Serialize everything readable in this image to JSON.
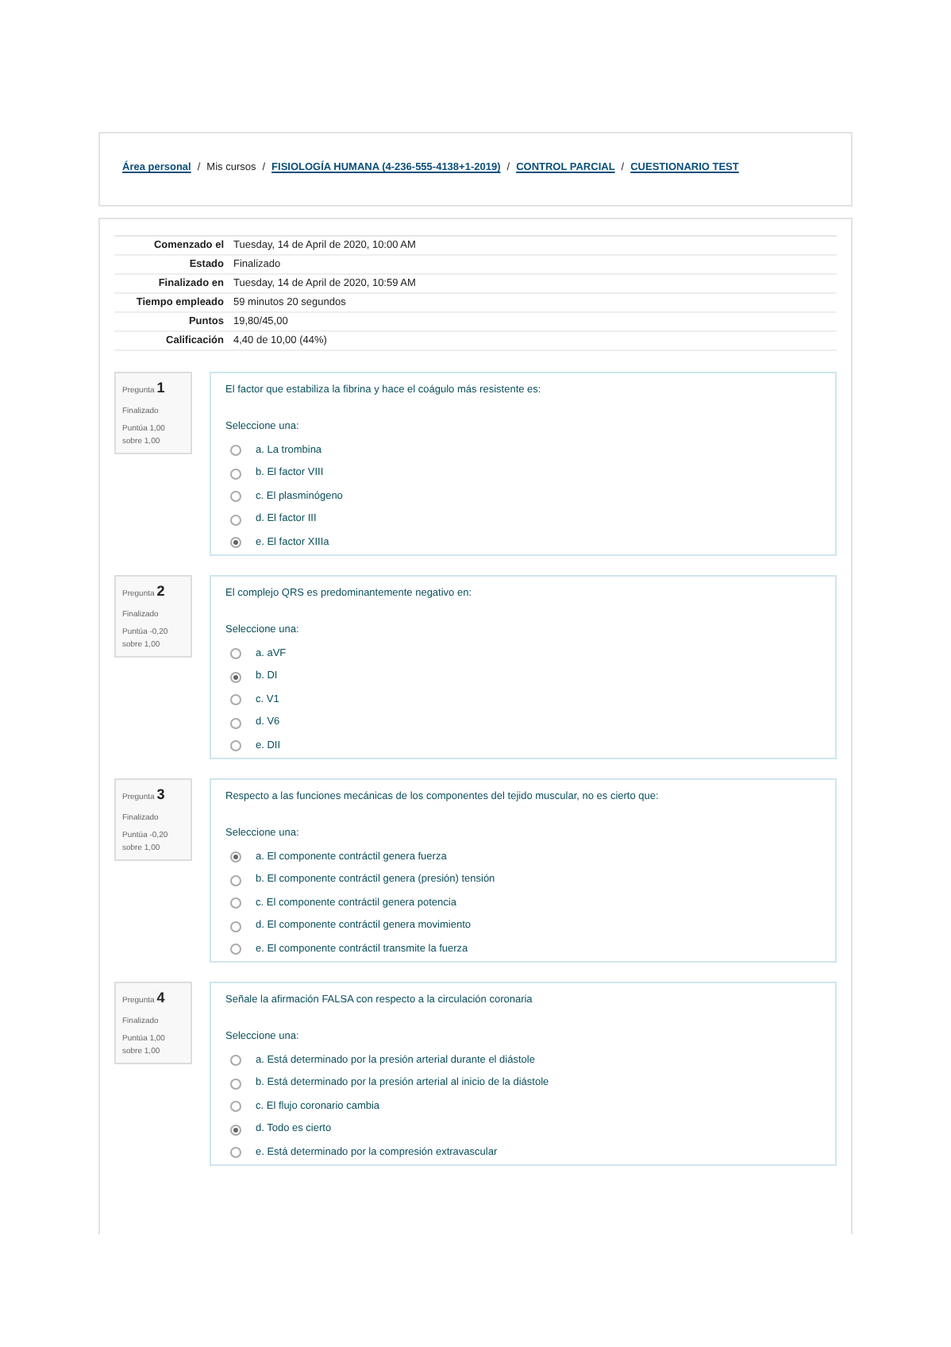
{
  "breadcrumb": {
    "separator": "/",
    "items": [
      {
        "label": "Área personal",
        "link": true
      },
      {
        "label": "Mis cursos",
        "link": false
      },
      {
        "label": "FISIOLOGÍA HUMANA (4-236-555-4138+1-2019)",
        "link": true
      },
      {
        "label": "CONTROL PARCIAL",
        "link": true
      },
      {
        "label": "CUESTIONARIO TEST",
        "link": true
      }
    ]
  },
  "summary": [
    {
      "label": "Comenzado el",
      "value": "Tuesday, 14 de April de 2020, 10:00 AM"
    },
    {
      "label": "Estado",
      "value": "Finalizado"
    },
    {
      "label": "Finalizado en",
      "value": "Tuesday, 14 de April de 2020, 10:59 AM"
    },
    {
      "label": "Tiempo empleado",
      "value": "59 minutos 20 segundos"
    },
    {
      "label": "Puntos",
      "value": "19,80/45,00"
    },
    {
      "label": "Calificación",
      "value": "4,40 de 10,00 (44%)"
    }
  ],
  "questions": [
    {
      "label": "Pregunta",
      "number": "1",
      "state": "Finalizado",
      "grade": "Puntúa 1,00 sobre 1,00",
      "text": "El factor que estabiliza la fibrina y hace el coágulo más resistente es:",
      "prompt": "Seleccione una:",
      "options": [
        {
          "label": "a. La trombina",
          "selected": false
        },
        {
          "label": "b. El factor VIII",
          "selected": false
        },
        {
          "label": "c. El plasminógeno",
          "selected": false
        },
        {
          "label": "d. El factor III",
          "selected": false
        },
        {
          "label": "e. El factor XIIIa",
          "selected": true
        }
      ]
    },
    {
      "label": "Pregunta",
      "number": "2",
      "state": "Finalizado",
      "grade": "Puntúa -0,20 sobre 1,00",
      "text": "El complejo QRS es predominantemente negativo en:",
      "prompt": "Seleccione una:",
      "options": [
        {
          "label": "a. aVF",
          "selected": false
        },
        {
          "label": "b. DI",
          "selected": true
        },
        {
          "label": "c. V1",
          "selected": false
        },
        {
          "label": "d. V6",
          "selected": false
        },
        {
          "label": "e. DII",
          "selected": false
        }
      ]
    },
    {
      "label": "Pregunta",
      "number": "3",
      "state": "Finalizado",
      "grade": "Puntúa -0,20 sobre 1,00",
      "text": "Respecto a las funciones mecánicas de los componentes del tejido muscular, no es cierto que:",
      "prompt": "Seleccione una:",
      "options": [
        {
          "label": "a. El componente contráctil genera fuerza",
          "selected": true
        },
        {
          "label": "b. El componente contráctil genera (presión) tensión",
          "selected": false
        },
        {
          "label": "c. El componente contráctil genera potencia",
          "selected": false
        },
        {
          "label": "d. El componente contráctil genera movimiento",
          "selected": false
        },
        {
          "label": "e. El componente contráctil transmite la fuerza",
          "selected": false
        }
      ]
    },
    {
      "label": "Pregunta",
      "number": "4",
      "state": "Finalizado",
      "grade": "Puntúa 1,00 sobre 1,00",
      "text": "Señale la afirmación FALSA con respecto a la circulación coronaria",
      "prompt": "Seleccione una:",
      "options": [
        {
          "label": "a. Está determinado por la presión arterial durante el diástole",
          "selected": false
        },
        {
          "label": "b. Está determinado por la presión arterial al inicio de la diástole",
          "selected": false
        },
        {
          "label": "c. El flujo coronario cambia",
          "selected": false
        },
        {
          "label": "d. Todo es cierto",
          "selected": true
        },
        {
          "label": "e. Está determinado por la compresión extravascular",
          "selected": false
        }
      ]
    }
  ]
}
